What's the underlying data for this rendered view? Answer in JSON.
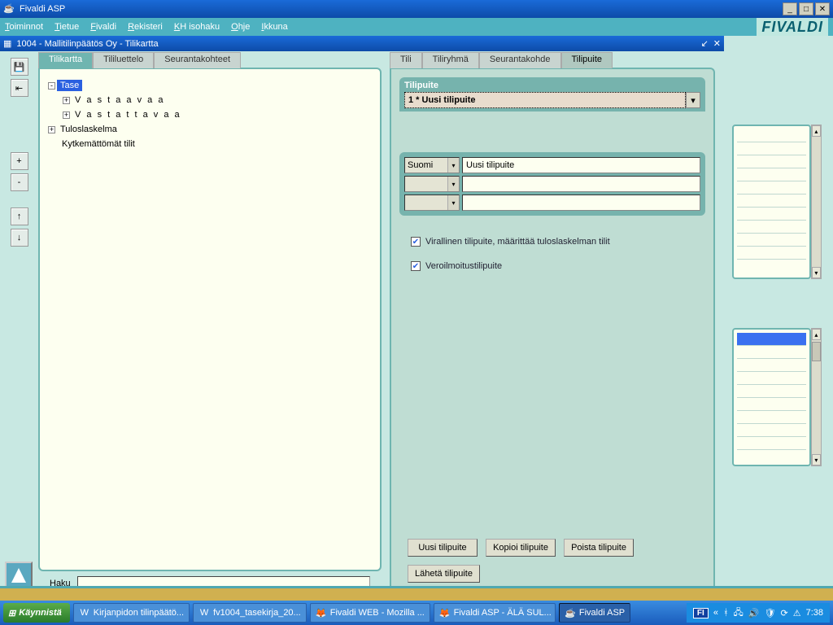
{
  "window": {
    "title": "Fivaldi ASP"
  },
  "menu": {
    "items": [
      "Toiminnot",
      "Tietue",
      "Fivaldi",
      "Rekisteri",
      "KH isohaku",
      "Ohje",
      "Ikkuna"
    ],
    "brand": "FIVALDI"
  },
  "subwindow": {
    "title": "1004 - Mallitilinpäätös Oy - Tilikartta"
  },
  "left_tabs": {
    "t1": "Tilikartta",
    "t2": "Tililuettelo",
    "t3": "Seurantakohteet",
    "active": "Tilikartta"
  },
  "tree": {
    "n0": "Tase",
    "n1": "V a s t a a v a a",
    "n2": "V a s t a t t a v a a",
    "n3": "Tuloslaskelma",
    "n4": "Kytkemättömät tilit"
  },
  "haku": {
    "label": "Haku",
    "value": ""
  },
  "right_tabs": {
    "t1": "Tili",
    "t2": "Tiliryhmä",
    "t3": "Seurantakohde",
    "t4": "Tilipuite",
    "active": "Tilipuite"
  },
  "tilipuite": {
    "header": "Tilipuite",
    "selected": "1 * Uusi tilipuite",
    "lang1": "Suomi",
    "name1": "Uusi tilipuite",
    "lang2": "",
    "name2": "",
    "lang3": "",
    "name3": "",
    "chk1": "Virallinen tilipuite, määrittää tuloslaskelman tilit",
    "chk2": "Veroilmoitustilipuite",
    "chk1_checked": true,
    "chk2_checked": true,
    "buttons": {
      "uusi": "Uusi tilipuite",
      "kopioi": "Kopioi tilipuite",
      "poista": "Poista tilipuite",
      "laheta": "Lähetä tilipuite"
    }
  },
  "toolbar_icons": {
    "save": "💾",
    "import": "⇤",
    "plus": "+",
    "minus": "-",
    "up": "↑",
    "down": "↓"
  },
  "taskbar": {
    "start": "Käynnistä",
    "tasks": [
      {
        "icon": "📘",
        "label": "Kirjanpidon tilinpäätö..."
      },
      {
        "icon": "📘",
        "label": "fv1004_tasekirja_20..."
      },
      {
        "icon": "🦊",
        "label": "Fivaldi WEB - Mozilla ..."
      },
      {
        "icon": "🦊",
        "label": "Fivaldi ASP - ÄLÄ SUL..."
      },
      {
        "icon": "☕",
        "label": "Fivaldi ASP",
        "active": true
      }
    ],
    "clock": "7:38",
    "lang_ind": "FI"
  }
}
